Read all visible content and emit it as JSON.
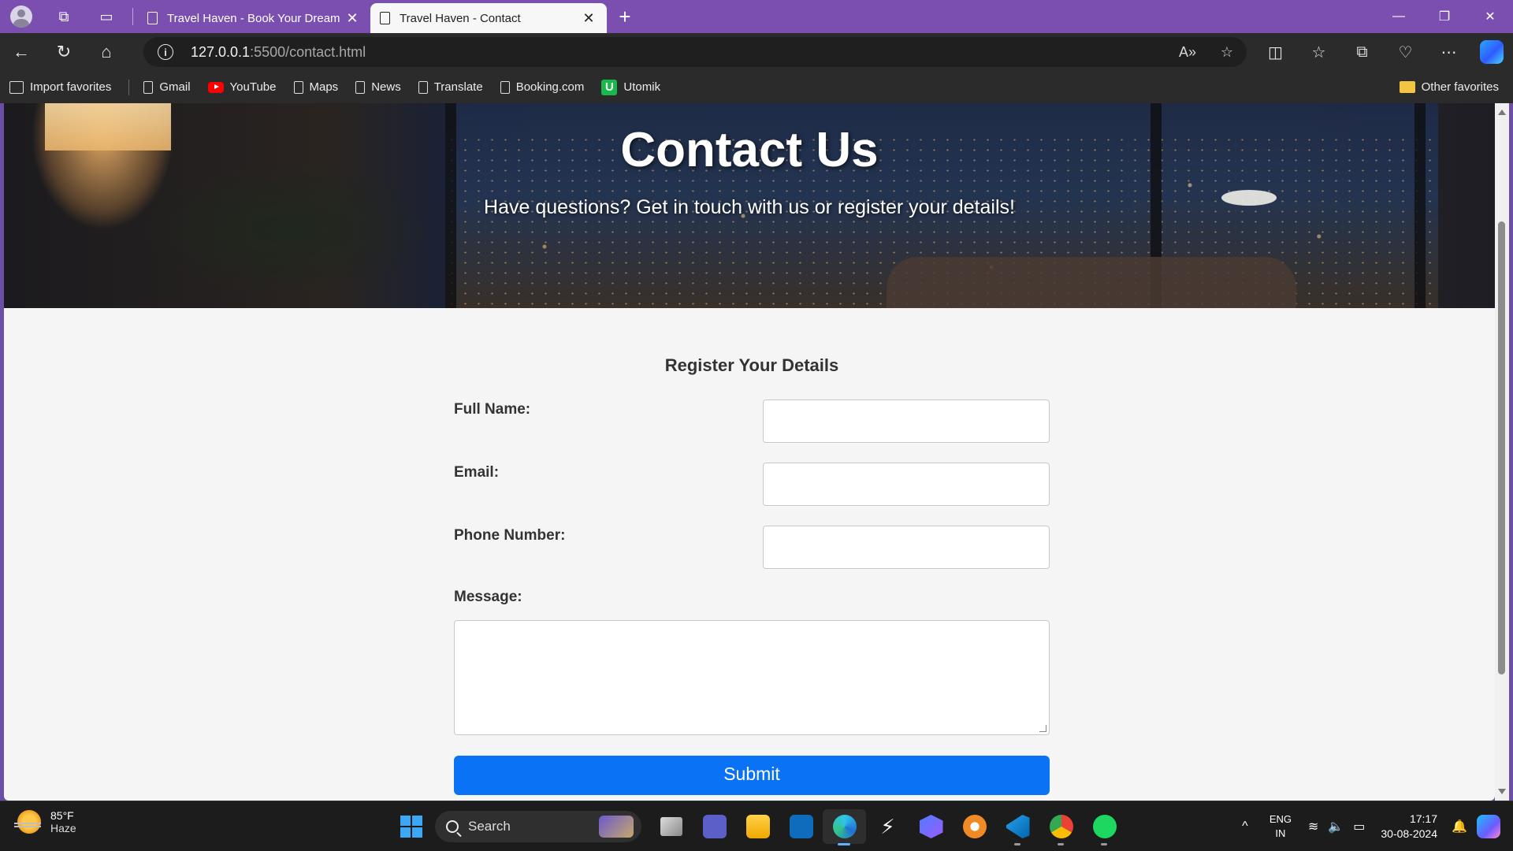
{
  "browser": {
    "tabs": [
      {
        "title": "Travel Haven - Book Your Dream Stay",
        "active": false
      },
      {
        "title": "Travel Haven - Contact",
        "active": true
      }
    ],
    "url_host": "127.0.0.1",
    "url_rest": ":5500/contact.html",
    "favorites": [
      {
        "label": "Import favorites",
        "icon": "import-icon"
      },
      {
        "label": "Gmail",
        "icon": "page-icon"
      },
      {
        "label": "YouTube",
        "icon": "youtube-icon"
      },
      {
        "label": "Maps",
        "icon": "page-icon"
      },
      {
        "label": "News",
        "icon": "page-icon"
      },
      {
        "label": "Translate",
        "icon": "page-icon"
      },
      {
        "label": "Booking.com",
        "icon": "page-icon"
      },
      {
        "label": "Utomik",
        "icon": "utomik-icon"
      }
    ],
    "other_favorites": "Other favorites",
    "colors": {
      "titlebar": "#7b4fb0",
      "toolbar": "#2b2b2b"
    }
  },
  "page": {
    "hero": {
      "title": "Contact Us",
      "subtitle": "Have questions? Get in touch with us or register your details!"
    },
    "form": {
      "title": "Register Your Details",
      "fields": [
        {
          "label": "Full Name:",
          "value": ""
        },
        {
          "label": "Email:",
          "value": ""
        },
        {
          "label": "Phone Number:",
          "value": ""
        }
      ],
      "message_label": "Message:",
      "message_value": "",
      "submit_label": "Submit",
      "submit_color": "#0a72f5"
    }
  },
  "taskbar": {
    "weather_temp": "85°F",
    "weather_desc": "Haze",
    "search_placeholder": "Search",
    "apps": [
      "task-view",
      "teams",
      "file-explorer",
      "outlook",
      "edge",
      "app-arrow",
      "app-hex",
      "app-orange",
      "vscode",
      "chrome",
      "spotify"
    ],
    "language_line1": "ENG",
    "language_line2": "IN",
    "time": "17:17",
    "date": "30-08-2024"
  }
}
